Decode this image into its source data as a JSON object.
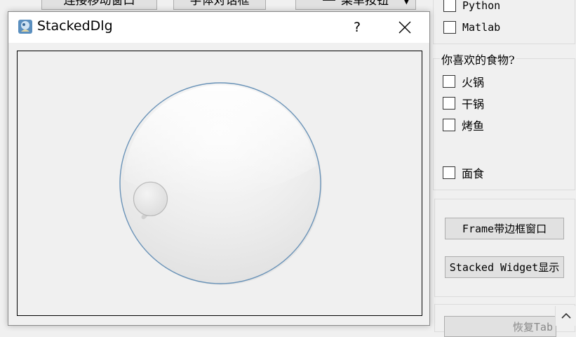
{
  "background_window": {
    "top_buttons": [
      "连接移动窗口",
      "字体对话框",
      "菜单按钮"
    ],
    "languages": [
      "Python",
      "Matlab"
    ],
    "food_group_title": "你喜欢的食物?",
    "foods": [
      "火锅",
      "干锅",
      "烤鱼",
      "面食"
    ],
    "frame_button": "Frame带边框窗口",
    "stacked_button": "Stacked Widget显示",
    "restore_button": "恢复Tab"
  },
  "dialog": {
    "title": "StackedDlg",
    "help_label": "?",
    "dial_value_fraction": 0.12
  }
}
